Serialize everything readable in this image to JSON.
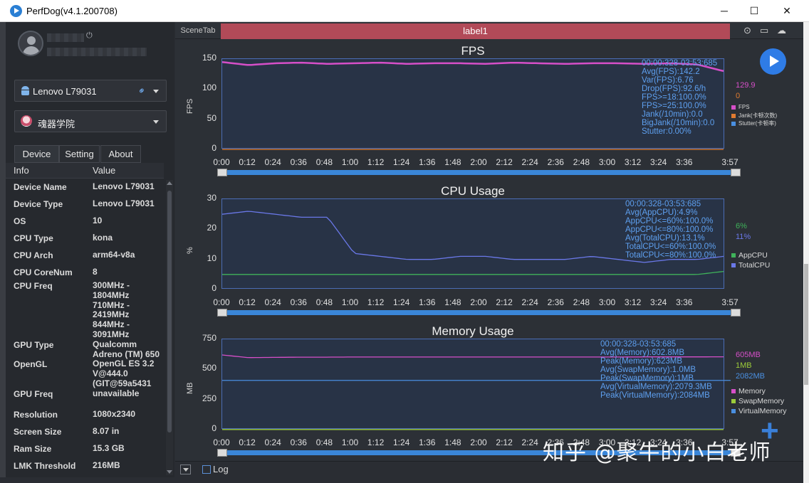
{
  "window": {
    "title": "PerfDog(v4.1.200708)",
    "minimize": "─",
    "maximize": "☐",
    "close": "✕"
  },
  "user": {
    "power_icon": "⏻"
  },
  "device_select": {
    "value": "Lenovo L79031",
    "icon": "android-icon",
    "link_glyph": "⚭"
  },
  "app_select": {
    "value": "魂器学院"
  },
  "tabs": [
    "Device",
    "Setting",
    "About"
  ],
  "info_table": {
    "headers": [
      "Info",
      "Value"
    ],
    "rows": [
      {
        "k": "Device Name",
        "v": "Lenovo L79031"
      },
      {
        "k": "Device Type",
        "v": "Lenovo L79031"
      },
      {
        "k": "OS",
        "v": "10"
      },
      {
        "k": "CPU Type",
        "v": "kona"
      },
      {
        "k": "CPU Arch",
        "v": "arm64-v8a"
      },
      {
        "k": "CPU CoreNum",
        "v": "8"
      },
      {
        "k": "CPU Freq",
        "v": "300MHz -\n1804MHz\n710MHz -\n2419MHz\n844MHz -\n3091MHz"
      },
      {
        "k": "GPU Type",
        "v": "Qualcomm\nAdreno (TM) 650"
      },
      {
        "k": "OpenGL",
        "v": "OpenGL ES 3.2\nV@444.0\n(GIT@59a5431"
      },
      {
        "k": "GPU Freq",
        "v": "unavailable"
      },
      {
        "k": "Resolution",
        "v": "1080x2340"
      },
      {
        "k": "Screen Size",
        "v": "8.07 in"
      },
      {
        "k": "Ram Size",
        "v": "15.3 GB"
      },
      {
        "k": "LMK Threshold",
        "v": "216MB"
      }
    ]
  },
  "scene": {
    "scenetab": "SceneTab",
    "label": "label1"
  },
  "top_icons": {
    "location": "⊙",
    "folder": "▭",
    "cloud": "☁"
  },
  "x_ticks": [
    "0:00",
    "0:12",
    "0:24",
    "0:36",
    "0:48",
    "1:00",
    "1:12",
    "1:24",
    "1:36",
    "1:48",
    "2:00",
    "2:12",
    "2:24",
    "2:36",
    "2:48",
    "3:00",
    "3:12",
    "3:24",
    "3:36",
    "3:57"
  ],
  "charts": {
    "fps": {
      "title": "FPS",
      "ylabel": "FPS",
      "yticks": [
        "150",
        "100",
        "50",
        "0"
      ],
      "stats": "00:00:328-03:53:685\nAvg(FPS):142.2\nVar(FPS):6.76\nDrop(FPS):92.6/h\nFPS>=18:100.0%\nFPS>=25:100.0%\nJank(/10min):0.0\nBigJank(/10min):0.0\nStutter:0.00%",
      "legend_values": [
        "129.9",
        "0"
      ],
      "legend": [
        "FPS",
        "Jank(卡顿次数)",
        "Stutter(卡顿率)"
      ],
      "colors": [
        "#d64fc8",
        "#e07b30",
        "#4a8fe0"
      ]
    },
    "cpu": {
      "title": "CPU Usage",
      "ylabel": "%",
      "yticks": [
        "30",
        "20",
        "10",
        "0"
      ],
      "stats": "00:00:328-03:53:685\nAvg(AppCPU):4.9%\nAppCPU<=60%:100.0%\nAppCPU<=80%:100.0%\nAvg(TotalCPU):13.1%\nTotalCPU<=60%:100.0%\nTotalCPU<=80%:100.0%",
      "legend_values": [
        "6%",
        "11%"
      ],
      "legend": [
        "AppCPU",
        "TotalCPU"
      ],
      "colors": [
        "#3fb35a",
        "#6a78e8"
      ]
    },
    "memory": {
      "title": "Memory Usage",
      "ylabel": "MB",
      "yticks": [
        "750",
        "500",
        "250",
        "0"
      ],
      "stats": "00:00:328-03:53:685\nAvg(Memory):602.8MB\nPeak(Memory):623MB\nAvg(SwapMemory):1.0MB\nPeak(SwapMemory):1MB\nAvg(VirtualMemory):2079.3MB\nPeak(VirtualMemory):2084MB",
      "legend_values": [
        "605MB",
        "1MB",
        "2082MB"
      ],
      "legend": [
        "Memory",
        "SwapMemory",
        "VirtualMemory"
      ],
      "colors": [
        "#d64fc8",
        "#9ccc3a",
        "#4a8fe0"
      ]
    }
  },
  "chart_data": [
    {
      "type": "line",
      "title": "FPS",
      "ylabel": "FPS",
      "ylim": [
        0,
        150
      ],
      "x": [
        "0:00",
        "0:12",
        "0:24",
        "0:36",
        "0:48",
        "1:00",
        "1:12",
        "1:24",
        "1:36",
        "1:48",
        "2:00",
        "2:12",
        "2:24",
        "2:36",
        "2:48",
        "3:00",
        "3:12",
        "3:24",
        "3:36",
        "3:57"
      ],
      "series": [
        {
          "name": "FPS",
          "values": [
            145,
            140,
            143,
            144,
            142,
            143,
            144,
            142,
            143,
            143,
            142,
            144,
            143,
            142,
            143,
            143,
            142,
            143,
            141,
            130
          ]
        },
        {
          "name": "Jank(卡顿次数)",
          "values": [
            0,
            0,
            0,
            0,
            0,
            0,
            0,
            0,
            0,
            0,
            0,
            0,
            0,
            0,
            0,
            0,
            0,
            0,
            0,
            0
          ]
        }
      ]
    },
    {
      "type": "line",
      "title": "CPU Usage",
      "ylabel": "%",
      "ylim": [
        0,
        30
      ],
      "x": [
        "0:00",
        "0:12",
        "0:24",
        "0:36",
        "0:48",
        "1:00",
        "1:12",
        "1:24",
        "1:36",
        "1:48",
        "2:00",
        "2:12",
        "2:24",
        "2:36",
        "2:48",
        "3:00",
        "3:12",
        "3:24",
        "3:36",
        "3:57"
      ],
      "series": [
        {
          "name": "AppCPU",
          "values": [
            5,
            5,
            5,
            5,
            5,
            5,
            5,
            5,
            5,
            5,
            5,
            5,
            5,
            5,
            5,
            5,
            5,
            5,
            5,
            6
          ]
        },
        {
          "name": "TotalCPU",
          "values": [
            25,
            26,
            25,
            24,
            24,
            12,
            11,
            10,
            10,
            11,
            11,
            10,
            10,
            10,
            11,
            10,
            9,
            10,
            10,
            11
          ]
        }
      ]
    },
    {
      "type": "line",
      "title": "Memory Usage",
      "ylabel": "MB",
      "ylim": [
        0,
        750
      ],
      "x": [
        "0:00",
        "0:12",
        "0:24",
        "0:36",
        "0:48",
        "1:00",
        "1:12",
        "1:24",
        "1:36",
        "1:48",
        "2:00",
        "2:12",
        "2:24",
        "2:36",
        "2:48",
        "3:00",
        "3:12",
        "3:24",
        "3:36",
        "3:57"
      ],
      "series": [
        {
          "name": "Memory",
          "values": [
            620,
            598,
            600,
            602,
            602,
            603,
            603,
            603,
            603,
            603,
            603,
            603,
            603,
            603,
            603,
            603,
            604,
            604,
            604,
            605
          ]
        },
        {
          "name": "SwapMemory",
          "values": [
            1,
            1,
            1,
            1,
            1,
            1,
            1,
            1,
            1,
            1,
            1,
            1,
            1,
            1,
            1,
            1,
            1,
            1,
            1,
            1
          ]
        }
      ]
    }
  ],
  "bottom": {
    "log_label": "Log"
  },
  "watermark": "知乎 @聚牛的小白老师"
}
